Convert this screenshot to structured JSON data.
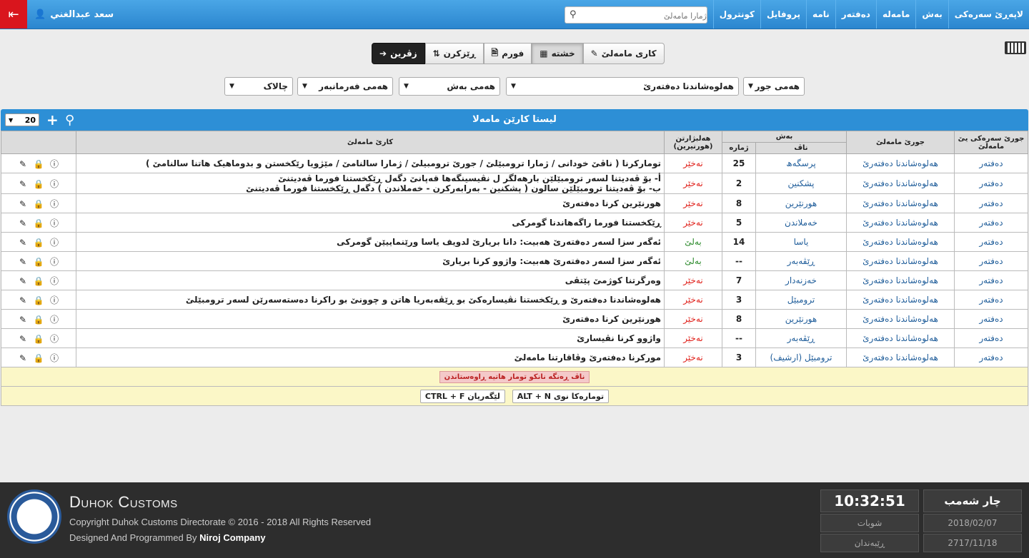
{
  "nav": {
    "user_name": "سعد عبدالغني",
    "search_placeholder": "ژمارا مامەلێ",
    "menu": [
      "لاپەڕێ سەرەکی",
      "بەش",
      "مامەلە",
      "دەفتەر",
      "نامە",
      "پروفایل",
      "کونترول"
    ]
  },
  "toolbar": {
    "karyi_mamale": "کاری مامەلێ",
    "khshta": "خشتە",
    "form": "فورم",
    "rezkrn": "ڕێزکرن",
    "zvrin": "زڤرین"
  },
  "filters": {
    "type": "هەمی جور",
    "category": "هەلوەشاندنا دەفتەرێ",
    "section": "هەمی بەش",
    "employee": "هەمی فەرمانبەر",
    "status": "چالاک"
  },
  "panel": {
    "title": "لیستا کارێن مامەلا",
    "page_size": "20"
  },
  "table": {
    "headers": {
      "main_type": "جورێ سەرەکی یێ مامەلێ",
      "type": "جورێ مامەلێ",
      "section": "بەش",
      "name": "ناڤ",
      "number": "ژمارە",
      "required": "هەلبژارتن (هورنیرین)",
      "task": "کارێ مامەلێ"
    },
    "rows": [
      {
        "main": "دەفتەر",
        "type": "هەلوەشاندنا دەفتەرێ",
        "name": "پرسگەھ",
        "number": "25",
        "required": "نەخێر",
        "status": "red",
        "task": [
          "تومارکرنا ( ناڤێ خودانی / ژمارا ترومبێلێ / جورێ ترومبیلێ / ژمارا سالنامێ / مێژویا رێکخستن و بدوماهیک هاتنا سالنامێ )"
        ]
      },
      {
        "main": "دەفتەر",
        "type": "هەلوەشاندنا دەفتەرێ",
        "name": "پشکنین",
        "number": "2",
        "required": "نەخێر",
        "status": "red",
        "task": [
          "أ- بۆ ڤەدیتنا لسەر ترومبێلێن بارھەلگر ل نڤیسینگەھا قەپانێ دگەل ڕێکخستنا فورما ڤەدیتنێ",
          "ب- بۆ ڤەدیتنا ترومبێلێن سالون ( پشکنین - بەرابەرکرن - خەملاندن ) دگەل ڕێکخستنا فورما ڤەدیتنێ"
        ]
      },
      {
        "main": "دەفتەر",
        "type": "هەلوەشاندنا دەفتەرێ",
        "name": "هورنێرین",
        "number": "8",
        "required": "نەخێر",
        "status": "red",
        "task": [
          "هورنێرین کرنا دەفتەرێ"
        ]
      },
      {
        "main": "دەفتەر",
        "type": "هەلوەشاندنا دەفتەرێ",
        "name": "خەملاندن",
        "number": "5",
        "required": "نەخێر",
        "status": "red",
        "task": [
          "ڕێکخستنا فورما راگەھاندنا گومرکی"
        ]
      },
      {
        "main": "دەفتەر",
        "type": "هەلوەشاندنا دەفتەرێ",
        "name": "یاسا",
        "number": "14",
        "required": "بەلێ",
        "status": "green",
        "task": [
          "ئەگەر سزا لسەر دەفتەرێ ھەبیت: دانا بریارێ لدویف یاسا ورێنماییێن گومرکی"
        ]
      },
      {
        "main": "دەفتەر",
        "type": "هەلوەشاندنا دەفتەرێ",
        "name": "ڕێڤەبەر",
        "number": "--",
        "required": "بەلێ",
        "status": "green",
        "task": [
          "ئەگەر سزا لسەر دەفتەرێ ھەبیت: واژوو کرنا بریارێ"
        ]
      },
      {
        "main": "دەفتەر",
        "type": "هەلوەشاندنا دەفتەرێ",
        "name": "خەزنەدار",
        "number": "7",
        "required": "نەخێر",
        "status": "red",
        "task": [
          "وەرگرتنا کوژمێ پێتڤی"
        ]
      },
      {
        "main": "دەفتەر",
        "type": "هەلوەشاندنا دەفتەرێ",
        "name": "ترومبێل",
        "number": "3",
        "required": "نەخێر",
        "status": "red",
        "task": [
          "هەلوەشاندنا دەفتەرێ و ڕێکخستنا نڤیسارەکێ بو ڕێڤەبەریا هاتن و چوونێ بو راکرنا دەستەسەرێن لسەر ترومبێلێ"
        ]
      },
      {
        "main": "دەفتەر",
        "type": "هەلوەشاندنا دەفتەرێ",
        "name": "هورنێرین",
        "number": "8",
        "required": "نەخێر",
        "status": "red",
        "task": [
          "هورنێرین کرنا دەفتەرێ"
        ]
      },
      {
        "main": "دەفتەر",
        "type": "هەلوەشاندنا دەفتەرێ",
        "name": "ڕێڤەبەر",
        "number": "--",
        "required": "نەخێر",
        "status": "red",
        "task": [
          "واژوو کرنا نڤیسارێ"
        ]
      },
      {
        "main": "دەفتەر",
        "type": "هەلوەشاندنا دەفتەرێ",
        "name": "ترومبێل (ارشیف)",
        "number": "3",
        "required": "نەخێر",
        "status": "red",
        "task": [
          "مورکرنا دەفتەرێ وڤاقارتنا مامەلێ"
        ]
      }
    ],
    "note": "ناڤ ڕەنگە نانکو تومار هاتیە ڕاوەستاندن",
    "hints": [
      {
        "key": "ALT + N",
        "label": "تومارەکا نوی"
      },
      {
        "key": "CTRL + F",
        "label": "لێگەریان"
      }
    ]
  },
  "footer": {
    "brand": "Duhok Customs",
    "copyright": "Copyright Duhok Customs Directorate © 2016 - 2018 All Rights Reserved",
    "designed_prefix": "Designed And Programmed By",
    "company": "Niroj Company",
    "time": "10:32:51",
    "day": "چار شەمب",
    "month_name": "شوبات",
    "date": "2018/02/07",
    "kurdish_month_label": "ڕێبەندان",
    "kurdish_date": "2717/11/18"
  },
  "colors": {
    "nav": "#2b86cf",
    "danger": "#d9151d",
    "no": "#e0201a",
    "yes": "#2b8a2b",
    "link": "#1f5d9a"
  }
}
